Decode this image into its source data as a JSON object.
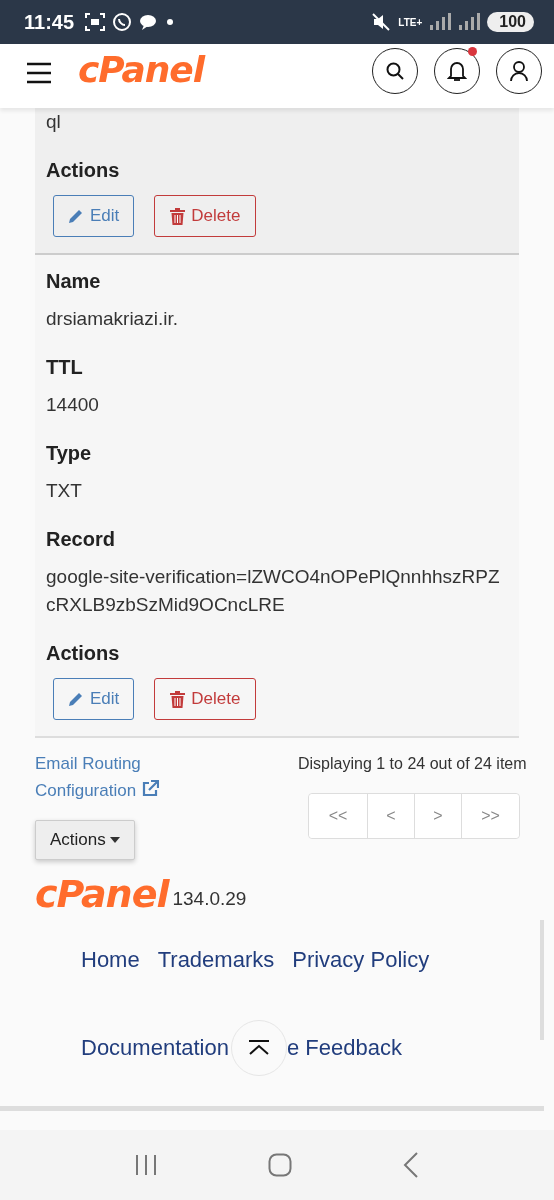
{
  "status_bar": {
    "time": "11:45",
    "network": "LTE+",
    "battery": "100"
  },
  "header": {
    "logo": "cPanel",
    "notification_dot": true
  },
  "records": [
    {
      "highlighted": true,
      "fields": [
        {
          "value": "ql"
        }
      ],
      "actions_label": "Actions",
      "buttons": [
        {
          "kind": "edit",
          "label": "Edit"
        },
        {
          "kind": "delete",
          "label": "Delete"
        }
      ]
    },
    {
      "highlighted": false,
      "fields": [
        {
          "label": "Name",
          "value": "drsiamakriazi.ir."
        },
        {
          "label": "TTL",
          "value": "14400"
        },
        {
          "label": "Type",
          "value": "TXT"
        },
        {
          "label": "Record",
          "value": "google-site-verification=lZWCO4nOPePlQnnhhszRPZcRXLB9zbSzMid9OCncLRE"
        }
      ],
      "actions_label": "Actions",
      "buttons": [
        {
          "kind": "edit",
          "label": "Edit"
        },
        {
          "kind": "delete",
          "label": "Delete"
        }
      ]
    }
  ],
  "email_routing_link": "Email Routing Configuration",
  "actions_dropdown": "Actions",
  "paging": {
    "summary": "Displaying 1 to 24 out of 24 item",
    "buttons": [
      "<<",
      "<",
      ">",
      ">>"
    ]
  },
  "footer": {
    "logo": "cPanel",
    "version": "134.0.29",
    "links": [
      [
        "Home",
        "Trademarks",
        "Privacy Policy"
      ],
      [
        "Documentation",
        "e Feedback"
      ]
    ]
  }
}
